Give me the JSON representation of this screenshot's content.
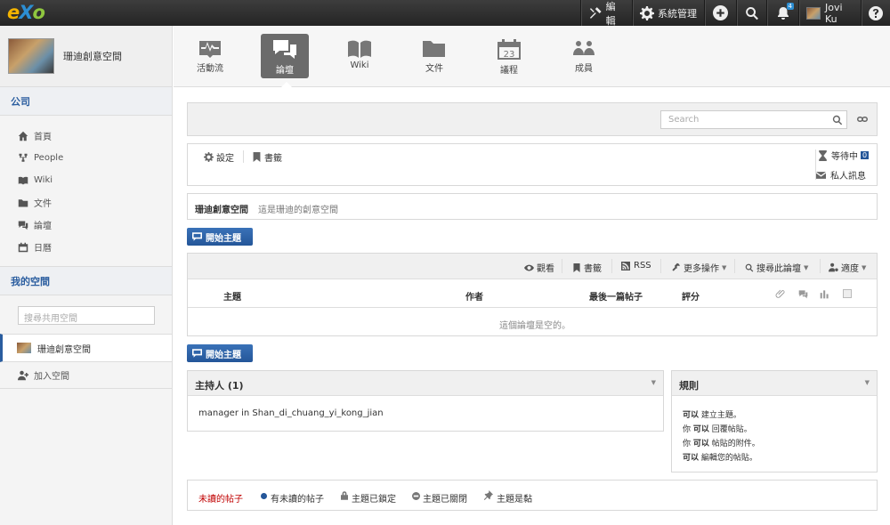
{
  "topbar": {
    "logo_e": "e",
    "logo_x": "X",
    "logo_o": "o",
    "edit": "編輯",
    "admin": "系統管理",
    "notif_count": "4",
    "user": "Jovi Ku"
  },
  "sidebar": {
    "space_name": "珊迪創意空間",
    "company": "公司",
    "items": [
      "首頁",
      "People",
      "Wiki",
      "文件",
      "論壇",
      "日曆"
    ],
    "my_spaces": "我的空間",
    "search_placeholder": "搜尋共用空間",
    "current_space": "珊迪創意空間",
    "join": "加入空間"
  },
  "tabs": [
    "活動流",
    "論壇",
    "Wiki",
    "文件",
    "議程",
    "成員"
  ],
  "calendar_day": "23",
  "search": {
    "placeholder": "Search"
  },
  "toolbar": {
    "settings": "設定",
    "bookmarks": "書籤",
    "pending": "等待中",
    "pending_count": "0",
    "private_msg": "私人訊息"
  },
  "forum": {
    "name": "珊迪創意空間",
    "desc": "這是珊迪的創意空間",
    "start_topic": "開始主題"
  },
  "actions": {
    "watch": "觀看",
    "bookmark": "書籤",
    "rss": "RSS",
    "more": "更多操作",
    "search_forum": "搜尋此論壇",
    "moderation": "適度"
  },
  "table": {
    "headers": [
      "主題",
      "作者",
      "最後一篇帖子",
      "評分"
    ],
    "empty": "這個論壇是空的。"
  },
  "moderators": {
    "title": "主持人 (1)",
    "content": "manager in Shan_di_chuang_yi_kong_jian"
  },
  "rules": {
    "title": "規則",
    "lines": [
      {
        "b": "可以",
        "t": "建立主題。",
        "p": ""
      },
      {
        "p": "你",
        "b": "可以",
        "t": "回覆帖貼。"
      },
      {
        "p": "你",
        "b": "可以",
        "t": "帖貼的附件。"
      },
      {
        "p": "",
        "b": "可以",
        "t": "編輯您的帖貼。"
      }
    ]
  },
  "legend": {
    "unread": "未讀的帖子",
    "has_unread": "有未讀的帖子",
    "locked": "主題已鎖定",
    "closed": "主題已關閉",
    "sticky": "主題是黏"
  },
  "colors": {
    "accent": "#2a5d9f",
    "unread_red": "#c00000"
  }
}
